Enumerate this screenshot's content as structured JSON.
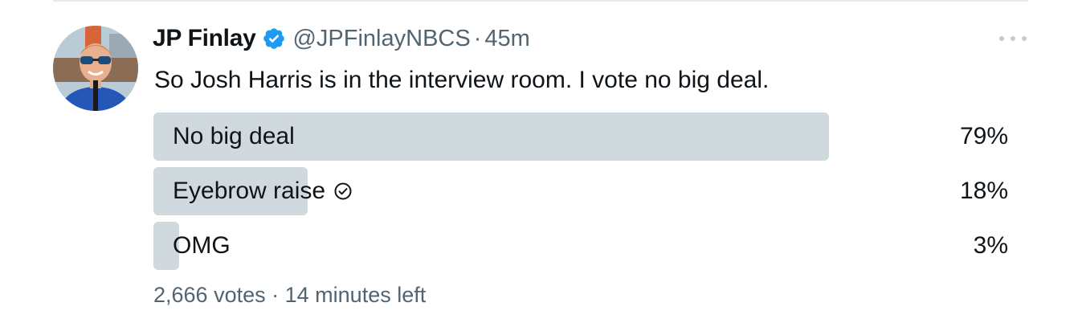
{
  "tweet": {
    "display_name": "JP Finlay",
    "handle": "@JPFinlayNBCS",
    "separator": "·",
    "time": "45m",
    "text": "So Josh Harris is in the interview room. I vote no big deal."
  },
  "poll": {
    "options": [
      {
        "label": "No big deal",
        "percent_label": "79%",
        "percent": 79,
        "voted": false
      },
      {
        "label": "Eyebrow raise",
        "percent_label": "18%",
        "percent": 18,
        "voted": true
      },
      {
        "label": "OMG",
        "percent_label": "3%",
        "percent": 3,
        "voted": false
      }
    ],
    "votes": "2,666 votes",
    "meta_separator": "·",
    "time_left": "14 minutes left"
  },
  "colors": {
    "bar": "#cfd9de",
    "verified": "#1d9bf0",
    "secondary_text": "#536471",
    "primary_text": "#0f1419"
  },
  "icons": {
    "verified": "verified-badge-icon",
    "more": "more-dots-icon",
    "voted": "check-circle-icon"
  }
}
